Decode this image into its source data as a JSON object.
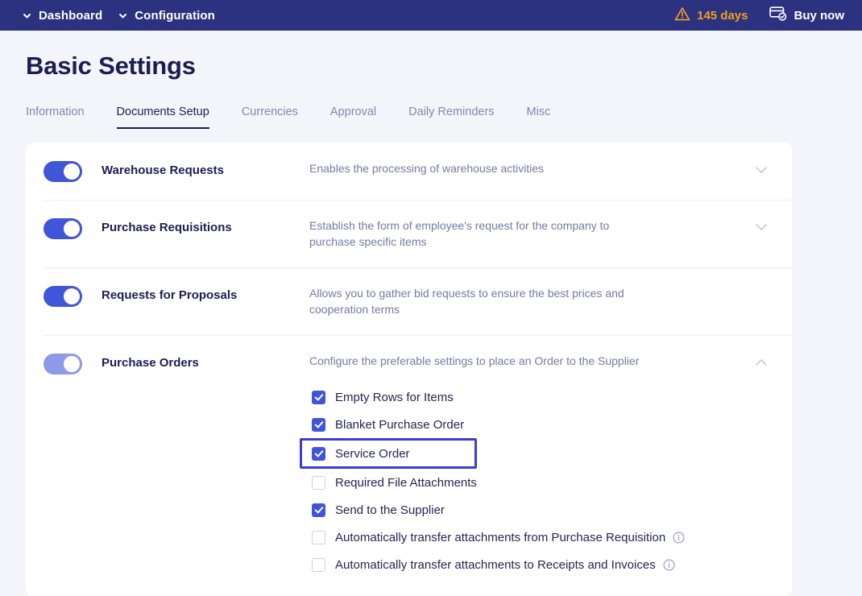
{
  "topbar": {
    "breadcrumbs": [
      {
        "label": "Dashboard",
        "icon": "chevron-down-icon"
      },
      {
        "label": "Configuration",
        "icon": "chevron-down-icon"
      }
    ],
    "trial": {
      "icon": "warning-triangle-icon",
      "label": "145 days",
      "color": "#f0a020"
    },
    "buy": {
      "icon": "payment-card-check-icon",
      "label": "Buy now"
    },
    "background": "#2c3180"
  },
  "page": {
    "title": "Basic Settings",
    "background": "#f4f4fb"
  },
  "tabs": [
    {
      "label": "Information",
      "active": false
    },
    {
      "label": "Documents Setup",
      "active": true
    },
    {
      "label": "Currencies",
      "active": false
    },
    {
      "label": "Approval",
      "active": false
    },
    {
      "label": "Daily Reminders",
      "active": false
    },
    {
      "label": "Misc",
      "active": false
    }
  ],
  "settings": [
    {
      "name": "Warehouse Requests",
      "description": "Enables the processing of warehouse activities",
      "toggle_on": true,
      "toggle_style": "solid",
      "chevron": "chevron-down-icon",
      "expanded": false
    },
    {
      "name": "Purchase Requisitions",
      "description": "Establish the form of employee's request for the company to purchase specific items",
      "toggle_on": true,
      "toggle_style": "solid",
      "chevron": "chevron-down-icon",
      "expanded": false
    },
    {
      "name": "Requests for Proposals",
      "description": "Allows you to gather bid requests to ensure the best prices and cooperation terms",
      "toggle_on": true,
      "toggle_style": "solid",
      "chevron": "none",
      "expanded": false
    },
    {
      "name": "Purchase Orders",
      "description": "Configure the preferable settings to place an Order to the Supplier",
      "toggle_on": true,
      "toggle_style": "light",
      "chevron": "chevron-up-icon",
      "expanded": true
    }
  ],
  "purchase_order_options": [
    {
      "label": "Empty Rows for Items",
      "checked": true,
      "info": false,
      "highlighted": false
    },
    {
      "label": "Blanket Purchase Order",
      "checked": true,
      "info": false,
      "highlighted": false
    },
    {
      "label": "Service Order",
      "checked": true,
      "info": false,
      "highlighted": true
    },
    {
      "label": "Required File Attachments",
      "checked": false,
      "info": false,
      "highlighted": false
    },
    {
      "label": "Send to the Supplier",
      "checked": true,
      "info": false,
      "highlighted": false
    },
    {
      "label": "Automatically transfer attachments from Purchase Requisition",
      "checked": false,
      "info": true,
      "highlighted": false
    },
    {
      "label": "Automatically transfer attachments to Receipts and Invoices",
      "checked": false,
      "info": true,
      "highlighted": false
    }
  ],
  "colors": {
    "accent": "#4055d8",
    "accent_light": "#8e99e8",
    "highlight_border": "#3b3ed2",
    "header_bg": "#2c3180",
    "warning": "#f0a020",
    "title": "#1b1e51",
    "muted": "#737ba4"
  }
}
